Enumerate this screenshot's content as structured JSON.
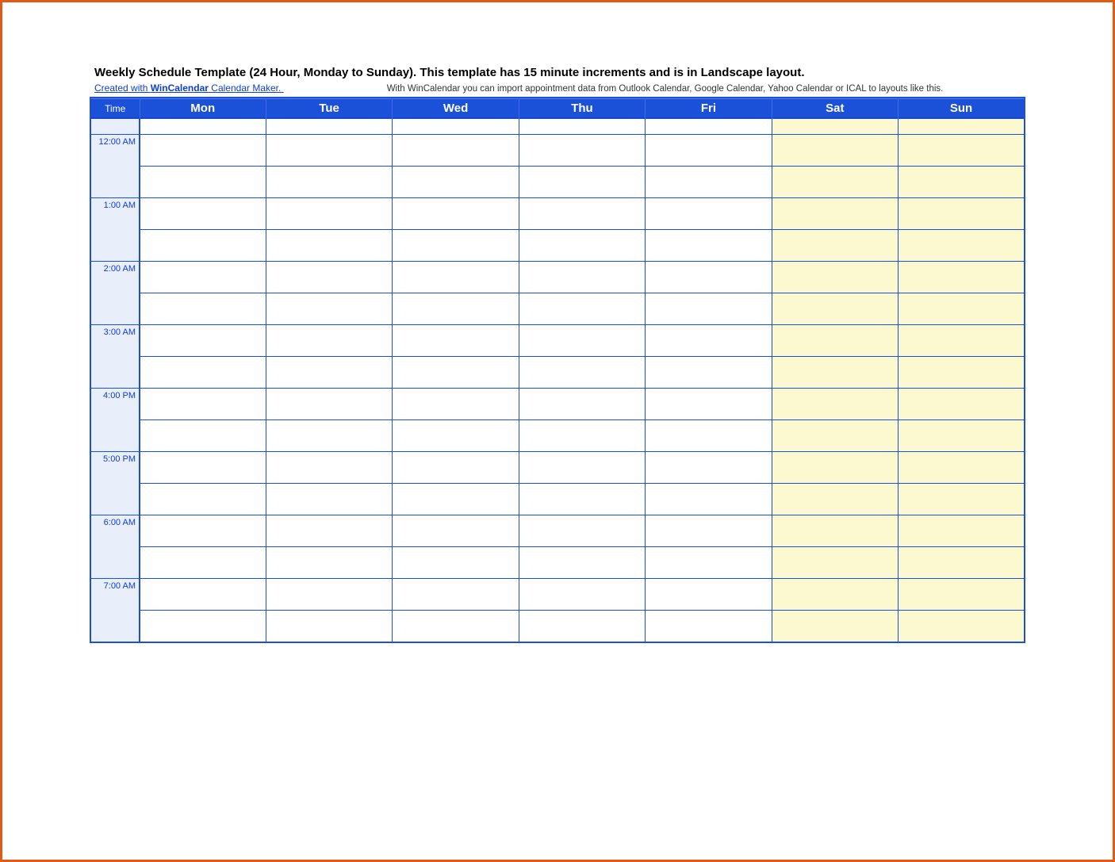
{
  "header": {
    "title": "Weekly Schedule Template (24 Hour, Monday to Sunday).  This template has 15 minute increments and is in Landscape layout.",
    "credit_prefix": "Created with ",
    "credit_brand": "WinCalendar",
    "credit_suffix": " Calendar Maker.",
    "note": "With WinCalendar you can import appointment data from Outlook Calendar, Google Calendar, Yahoo Calendar or ICAL to layouts like this."
  },
  "columns": {
    "time": "Time",
    "days": [
      "Mon",
      "Tue",
      "Wed",
      "Thu",
      "Fri",
      "Sat",
      "Sun"
    ]
  },
  "weekend_days": [
    "Sat",
    "Sun"
  ],
  "time_labels": [
    "12:00 AM",
    "1:00 AM",
    "2:00 AM",
    "3:00 AM",
    "4:00 PM",
    "5:00 PM",
    "6:00 AM",
    "7:00 AM"
  ],
  "colors": {
    "frame_border": "#e25b16",
    "header_bg": "#1b50d9",
    "header_text": "#ffffff",
    "grid_border": "#1b50d9",
    "time_col_bg": "#e9effa",
    "weekend_bg": "#fcf8cf",
    "link": "#0b3fd6"
  }
}
